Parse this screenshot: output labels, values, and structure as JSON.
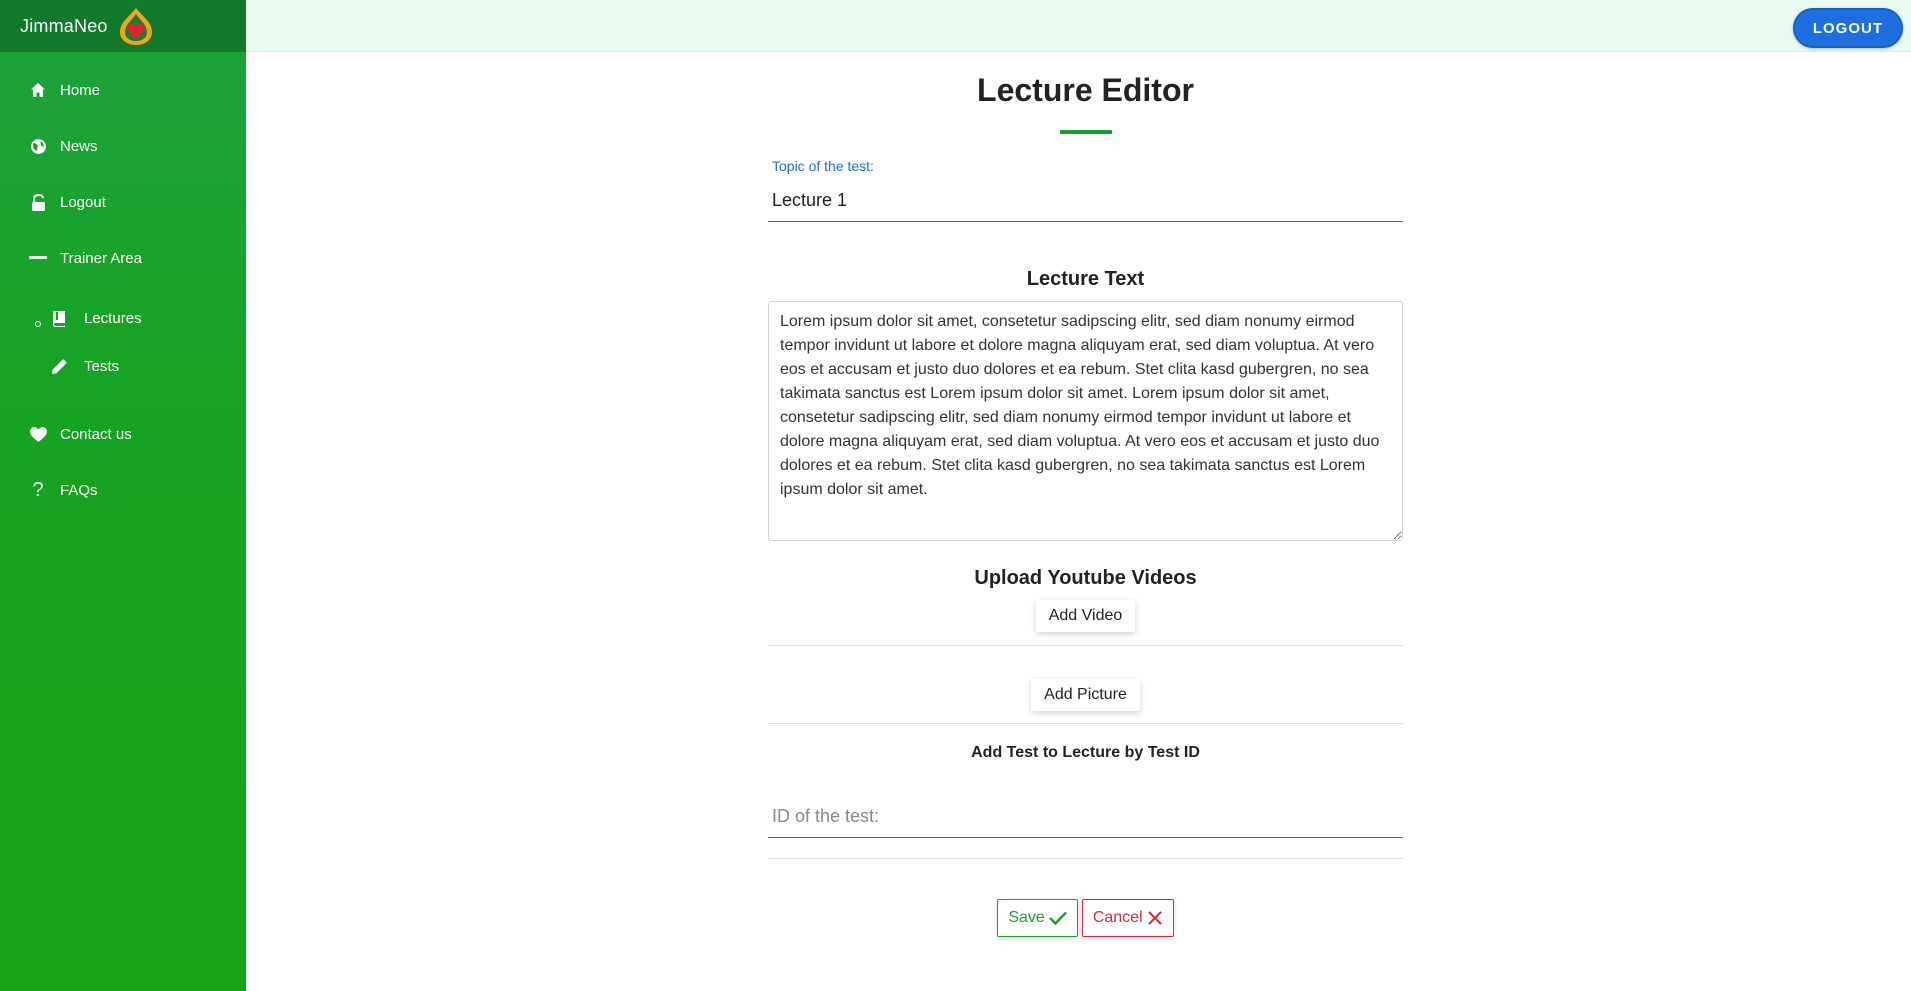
{
  "brand": {
    "name": "JimmaNeo",
    "logo_icon": "heart-drop-logo"
  },
  "colors": {
    "sidebar": "#16a316",
    "brand_bar": "#117a2a",
    "topbar": "#e9fbef",
    "accent": "#1d6fe0",
    "save": "#1b9e30",
    "cancel": "#d42a3c"
  },
  "sidebar": {
    "items": [
      {
        "label": "Home",
        "icon": "home-icon"
      },
      {
        "label": "News",
        "icon": "globe-icon"
      },
      {
        "label": "Logout",
        "icon": "unlock-icon"
      },
      {
        "label": "Trainer Area",
        "icon": "minus-icon"
      }
    ],
    "sub_items": [
      {
        "label": "Lectures",
        "icon": "book-icon"
      },
      {
        "label": "Tests",
        "icon": "pencil-icon"
      }
    ],
    "bottom_items": [
      {
        "label": "Contact us",
        "icon": "heart-icon"
      },
      {
        "label": "FAQs",
        "icon": "question-icon"
      }
    ]
  },
  "header": {
    "logout_label": "LOGOUT"
  },
  "editor": {
    "title": "Lecture Editor",
    "topic_label": "Topic of the test:",
    "topic_value": "Lecture 1",
    "lecture_text_title": "Lecture Text",
    "lecture_text": "Lorem ipsum dolor sit amet, consetetur sadipscing elitr, sed diam nonumy eirmod tempor invidunt ut labore et dolore magna aliquyam erat, sed diam voluptua. At vero eos et accusam et justo duo dolores et ea rebum. Stet clita kasd gubergren, no sea takimata sanctus est Lorem ipsum dolor sit amet. Lorem ipsum dolor sit amet, consetetur sadipscing elitr, sed diam nonumy eirmod tempor invidunt ut labore et dolore magna aliquyam erat, sed diam voluptua. At vero eos et accusam et justo duo dolores et ea rebum. Stet clita kasd gubergren, no sea takimata sanctus est Lorem ipsum dolor sit amet.",
    "upload_title": "Upload Youtube Videos",
    "add_video_label": "Add Video",
    "add_picture_label": "Add Picture",
    "add_test_title": "Add Test to Lecture by Test ID",
    "test_id_placeholder": "ID of the test:",
    "save_label": "Save",
    "cancel_label": "Cancel"
  }
}
